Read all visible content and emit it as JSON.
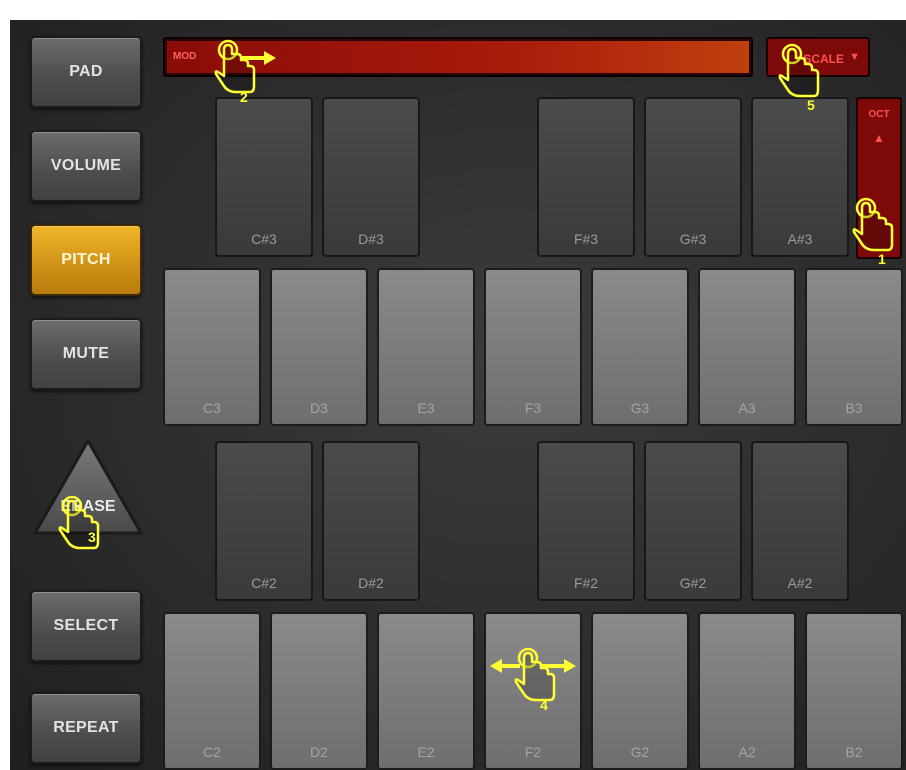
{
  "sidebar": {
    "buttons": [
      {
        "label": "PAD",
        "active": false
      },
      {
        "label": "VOLUME",
        "active": false
      },
      {
        "label": "PITCH",
        "active": true
      },
      {
        "label": "MUTE",
        "active": false
      }
    ],
    "erase_label": "ERASE",
    "select_label": "SELECT",
    "repeat_label": "REPEAT"
  },
  "mod": {
    "label": "MOD"
  },
  "scale": {
    "label": "SCALE",
    "arrow": "▼"
  },
  "oct": {
    "label": "OCT",
    "up_arrow": "▲"
  },
  "keys": {
    "upper_black": [
      "C#3",
      "D#3",
      "F#3",
      "G#3",
      "A#3"
    ],
    "upper_white": [
      "C3",
      "D3",
      "E3",
      "F3",
      "G3",
      "A3",
      "B3"
    ],
    "lower_black": [
      "C#2",
      "D#2",
      "F#2",
      "G#2",
      "A#2"
    ],
    "lower_white": [
      "C2",
      "D2",
      "E2",
      "F2",
      "G2",
      "A2",
      "B2"
    ]
  },
  "gestures": [
    {
      "number": "1",
      "icon": "tap-hand-icon"
    },
    {
      "number": "2",
      "icon": "swipe-right-hand-icon"
    },
    {
      "number": "3",
      "icon": "tap-hand-icon"
    },
    {
      "number": "4",
      "icon": "swipe-horizontal-hand-icon"
    },
    {
      "number": "5",
      "icon": "tap-hand-icon"
    }
  ],
  "colors": {
    "accent": "#e2a21c",
    "mod_red": "#a81c0b",
    "gesture_yellow": "#ffff33"
  }
}
